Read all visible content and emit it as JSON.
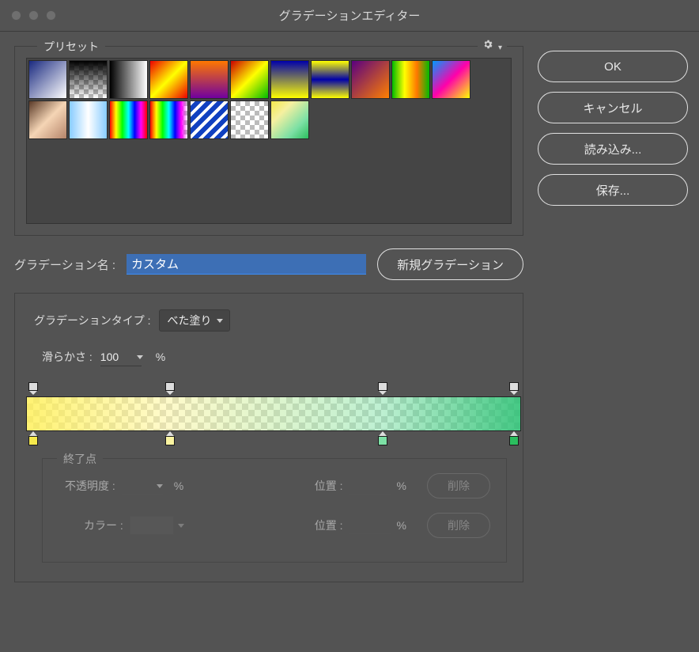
{
  "window": {
    "title": "グラデーションエディター"
  },
  "presets": {
    "label": "プリセット"
  },
  "buttons": {
    "ok": "OK",
    "cancel": "キャンセル",
    "load": "読み込み...",
    "save": "保存...",
    "new": "新規グラデーション"
  },
  "name_row": {
    "label": "グラデーション名 :",
    "value": "カスタム"
  },
  "type_group": {
    "type_label": "グラデーションタイプ :",
    "type_value": "べた塗り",
    "smooth_label": "滑らかさ :",
    "smooth_value": "100",
    "percent": "%"
  },
  "gradient": {
    "opacity_stops": [
      {
        "pos": 1.5
      },
      {
        "pos": 29
      },
      {
        "pos": 72
      },
      {
        "pos": 98.5
      }
    ],
    "color_stops": [
      {
        "pos": 1.5,
        "color": "#f5e84b"
      },
      {
        "pos": 29,
        "color": "#faf3a0"
      },
      {
        "pos": 72,
        "color": "#7de0a5"
      },
      {
        "pos": 98.5,
        "color": "#2bbd5e"
      }
    ]
  },
  "endpoint": {
    "label": "終了点",
    "opacity_label": "不透明度 :",
    "color_label": "カラー :",
    "location_label": "位置 :",
    "percent": "%",
    "delete": "削除"
  }
}
